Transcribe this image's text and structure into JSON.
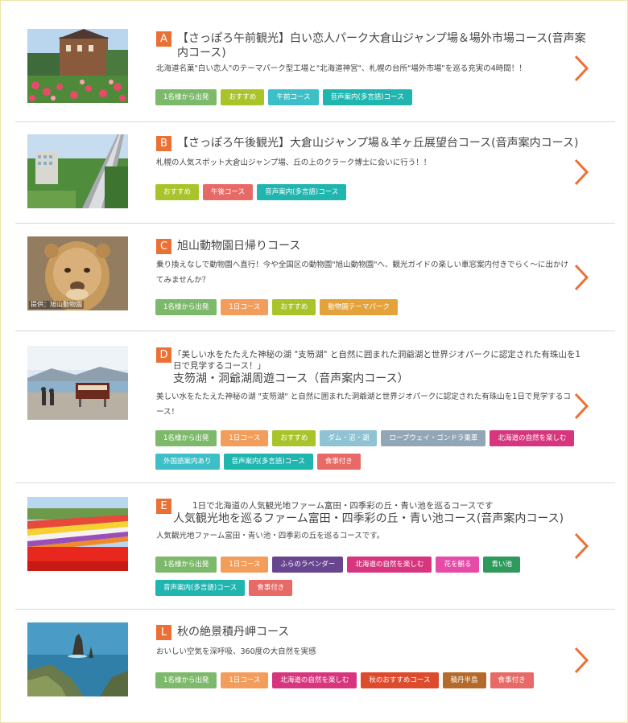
{
  "tag_colors": {
    "green": "#7cb96a",
    "olive": "#a8c42a",
    "teal": "#3dbfc8",
    "turquoise": "#21b5b0",
    "salmon": "#e76a66",
    "orange": "#f39d5d",
    "amber": "#e3a23a",
    "lightblue": "#8fc3d3",
    "slate": "#93a6b6",
    "magenta": "#d7367e",
    "purple": "#67468f",
    "pink": "#e64ba8",
    "darkgreen": "#2f9a5c",
    "red": "#de4a2c",
    "brown": "#b36a2a"
  },
  "arrow_color": "#ec7034",
  "courses": [
    {
      "letter": "A",
      "title": "【さっぽろ午前観光】白い恋人パーク大倉山ジャンプ場＆場外市場コース(音声案内コース)",
      "desc": "北海道名菓\"白い恋人\"のテーマパーク型工場と\"北海道神宮\"、札幌の台所\"場外市場\"を巡る充実の4時間！！",
      "tags": [
        {
          "label": "1名様から出発",
          "color": "green"
        },
        {
          "label": "おすすめ",
          "color": "olive"
        },
        {
          "label": "午前コース",
          "color": "teal"
        },
        {
          "label": "音声案内(多言語)コース",
          "color": "turquoise"
        }
      ]
    },
    {
      "letter": "B",
      "title": "【さっぽろ午後観光】大倉山ジャンプ場＆羊ヶ丘展望台コース(音声案内コース)",
      "desc": "札幌の人気スポット大倉山ジャンプ場、丘の上のクラーク博士に会いに行う！！",
      "tags": [
        {
          "label": "おすすめ",
          "color": "olive"
        },
        {
          "label": "午後コース",
          "color": "salmon"
        },
        {
          "label": "音声案内(多言語)コース",
          "color": "turquoise"
        }
      ]
    },
    {
      "letter": "C",
      "title": "旭山動物園日帰りコース",
      "credit": "提供：旭山動物園",
      "desc": "乗り換えなしで動物園へ直行！今や全国区の動物園\"旭山動物園\"へ、観光ガイドの楽しい車窓案内付きでらく〜に出かけてみませんか？",
      "tags": [
        {
          "label": "1名様から出発",
          "color": "green"
        },
        {
          "label": "1日コース",
          "color": "orange"
        },
        {
          "label": "おすすめ",
          "color": "olive"
        },
        {
          "label": "動物園テーマパーク",
          "color": "amber"
        }
      ]
    },
    {
      "letter": "D",
      "title_pre": "「美しい水をたたえた神秘の湖 \"支笏湖\" と自然に囲まれた洞爺湖と世界ジオパークに認定された有珠山を1日で見学するコース！」",
      "title": "支笏湖・洞爺湖周遊コース（音声案内コース）",
      "desc": "美しい水をたたえた神秘の湖 \"支笏湖\" と自然に囲まれた洞爺湖と世界ジオパークに認定された有珠山を1日で見学するコース！",
      "tags": [
        {
          "label": "1名様から出発",
          "color": "green"
        },
        {
          "label": "1日コース",
          "color": "orange"
        },
        {
          "label": "おすすめ",
          "color": "olive"
        },
        {
          "label": "ダム・沼・湖",
          "color": "lightblue"
        },
        {
          "label": "ロープウェイ・ゴンドラ乗車",
          "color": "slate"
        },
        {
          "label": "北海道の自然を楽しむ",
          "color": "magenta"
        },
        {
          "label": "外国語案内あり",
          "color": "teal"
        },
        {
          "label": "音声案内(多言語)コース",
          "color": "turquoise"
        },
        {
          "label": "食事付き",
          "color": "salmon"
        }
      ]
    },
    {
      "letter": "E",
      "title_pre": "1日で北海道の人気観光地ファーム富田・四季彩の丘・青い池を巡るコースです",
      "title": "人気観光地を巡るファーム富田・四季彩の丘・青い池コース(音声案内コース)",
      "desc": "人気観光地ファーム富田・青い池・四季彩の丘を巡るコースです。",
      "tags": [
        {
          "label": "1名様から出発",
          "color": "green"
        },
        {
          "label": "1日コース",
          "color": "orange"
        },
        {
          "label": "ふらのラベンダー",
          "color": "purple"
        },
        {
          "label": "北海道の自然を楽しむ",
          "color": "magenta"
        },
        {
          "label": "花を観る",
          "color": "pink"
        },
        {
          "label": "青い池",
          "color": "darkgreen"
        },
        {
          "label": "音声案内(多言語)コース",
          "color": "turquoise"
        },
        {
          "label": "食事付き",
          "color": "salmon"
        }
      ]
    },
    {
      "letter": "L",
      "title": "秋の絶景積丹岬コース",
      "desc": "おいしい空気を深呼吸、360度の大自然を実感",
      "tags": [
        {
          "label": "1名様から出発",
          "color": "green"
        },
        {
          "label": "1日コース",
          "color": "orange"
        },
        {
          "label": "北海道の自然を楽しむ",
          "color": "magenta"
        },
        {
          "label": "秋のおすすめコース",
          "color": "red"
        },
        {
          "label": "積丹半島",
          "color": "brown"
        },
        {
          "label": "食事付き",
          "color": "salmon"
        }
      ]
    }
  ]
}
